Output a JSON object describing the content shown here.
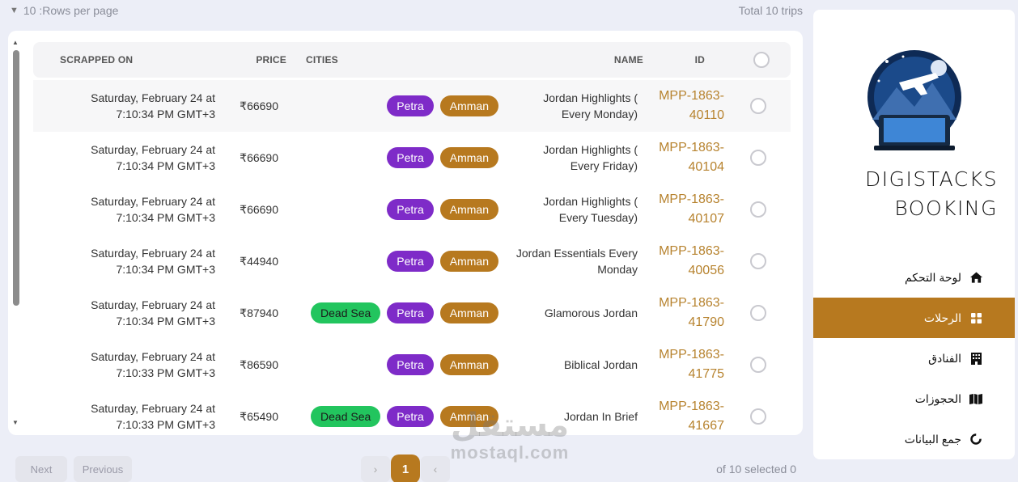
{
  "toolbar": {
    "rows_per_page": "10 :Rows per page",
    "total": "Total 10 trips"
  },
  "table": {
    "headers": {
      "scrapped_on": "SCRAPPED ON",
      "price": "PRICE",
      "cities": "CITIES",
      "name": "NAME",
      "id": "ID"
    },
    "rows": [
      {
        "scrapped_line1": "Saturday, February 24 at",
        "scrapped_line2": "7:10:34 PM GMT+3",
        "price": "₹66690",
        "cities": [
          "Petra",
          "Amman"
        ],
        "name_line1": "Jordan Highlights (",
        "name_line2": "Every Monday)",
        "id_line1": "MPP-1863-",
        "id_line2": "40110"
      },
      {
        "scrapped_line1": "Saturday, February 24 at",
        "scrapped_line2": "7:10:34 PM GMT+3",
        "price": "₹66690",
        "cities": [
          "Petra",
          "Amman"
        ],
        "name_line1": "Jordan Highlights (",
        "name_line2": "Every Friday)",
        "id_line1": "MPP-1863-",
        "id_line2": "40104"
      },
      {
        "scrapped_line1": "Saturday, February 24 at",
        "scrapped_line2": "7:10:34 PM GMT+3",
        "price": "₹66690",
        "cities": [
          "Petra",
          "Amman"
        ],
        "name_line1": "Jordan Highlights (",
        "name_line2": "Every Tuesday)",
        "id_line1": "MPP-1863-",
        "id_line2": "40107"
      },
      {
        "scrapped_line1": "Saturday, February 24 at",
        "scrapped_line2": "7:10:34 PM GMT+3",
        "price": "₹44940",
        "cities": [
          "Petra",
          "Amman"
        ],
        "name_line1": "Jordan Essentials Every",
        "name_line2": "Monday",
        "id_line1": "MPP-1863-",
        "id_line2": "40056"
      },
      {
        "scrapped_line1": "Saturday, February 24 at",
        "scrapped_line2": "7:10:34 PM GMT+3",
        "price": "₹87940",
        "cities": [
          "Dead Sea",
          "Petra",
          "Amman"
        ],
        "name_line1": "Glamorous Jordan",
        "name_line2": "",
        "id_line1": "MPP-1863-",
        "id_line2": "41790"
      },
      {
        "scrapped_line1": "Saturday, February 24 at",
        "scrapped_line2": "7:10:33 PM GMT+3",
        "price": "₹86590",
        "cities": [
          "Petra",
          "Amman"
        ],
        "name_line1": "Biblical Jordan",
        "name_line2": "",
        "id_line1": "MPP-1863-",
        "id_line2": "41775"
      },
      {
        "scrapped_line1": "Saturday, February 24 at",
        "scrapped_line2": "7:10:33 PM GMT+3",
        "price": "₹65490",
        "cities": [
          "Dead Sea",
          "Petra",
          "Amman"
        ],
        "name_line1": "Jordan In Brief",
        "name_line2": "",
        "id_line1": "MPP-1863-",
        "id_line2": "41667"
      }
    ]
  },
  "pagination": {
    "next": "Next",
    "previous": "Previous",
    "current_page": "1",
    "prev_arrow": "›",
    "next_arrow": "‹",
    "selected": "of 10 selected 0"
  },
  "sidebar": {
    "brand_line1": "DIGISTACKS",
    "brand_line2": "BOOKING",
    "items": [
      {
        "label": "لوحة التحكم",
        "icon": "home-icon",
        "active": false
      },
      {
        "label": "الرحلات",
        "icon": "grid-icon",
        "active": true
      },
      {
        "label": "الفنادق",
        "icon": "building-icon",
        "active": false
      },
      {
        "label": "الحجوزات",
        "icon": "map-icon",
        "active": false
      },
      {
        "label": "جمع البيانات",
        "icon": "loader-icon",
        "active": false
      }
    ]
  },
  "watermark": {
    "arabic": "مستقل",
    "latin": "mostaql.com"
  },
  "colors": {
    "accent": "#b7791f",
    "petra": "#7e2bc8",
    "dead_sea": "#22c55e",
    "id_text": "#b7832f"
  }
}
